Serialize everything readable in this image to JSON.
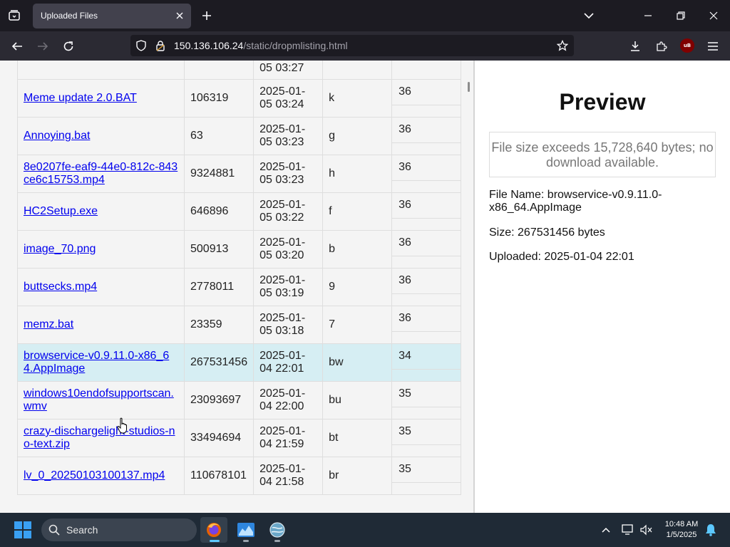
{
  "browser": {
    "tab_title": "Uploaded Files",
    "url_host": "150.136.106.24",
    "url_path": "/static/dropmlisting.html"
  },
  "file_list": {
    "partial_top_row": {
      "date": "05 03:27"
    },
    "rows": [
      {
        "name": "Meme update 2.0.BAT",
        "size": "106319",
        "date_line1": "2025-01-",
        "date_line2": "05 03:24",
        "hash": "k",
        "views": "36",
        "selected": false
      },
      {
        "name": "Annoying.bat",
        "size": "63",
        "date_line1": "2025-01-",
        "date_line2": "05 03:23",
        "hash": "g",
        "views": "36",
        "selected": false
      },
      {
        "name": "8e0207fe-eaf9-44e0-812c-843ce6c15753.mp4",
        "size": "9324881",
        "date_line1": "2025-01-",
        "date_line2": "05 03:23",
        "hash": "h",
        "views": "36",
        "selected": false
      },
      {
        "name": "HC2Setup.exe",
        "size": "646896",
        "date_line1": "2025-01-",
        "date_line2": "05 03:22",
        "hash": "f",
        "views": "36",
        "selected": false
      },
      {
        "name": "image_70.png",
        "size": "500913",
        "date_line1": "2025-01-",
        "date_line2": "05 03:20",
        "hash": "b",
        "views": "36",
        "selected": false
      },
      {
        "name": "buttsecks.mp4",
        "size": "2778011",
        "date_line1": "2025-01-",
        "date_line2": "05 03:19",
        "hash": "9",
        "views": "36",
        "selected": false
      },
      {
        "name": "memz.bat",
        "size": "23359",
        "date_line1": "2025-01-",
        "date_line2": "05 03:18",
        "hash": "7",
        "views": "36",
        "selected": false
      },
      {
        "name": "browservice-v0.9.11.0-x86_64.AppImage",
        "size": "267531456",
        "date_line1": "2025-01-",
        "date_line2": "04 22:01",
        "hash": "bw",
        "views": "34",
        "selected": true
      },
      {
        "name": "windows10endofsupportscan.wmv",
        "size": "23093697",
        "date_line1": "2025-01-",
        "date_line2": "04 22:00",
        "hash": "bu",
        "views": "35",
        "selected": false
      },
      {
        "name": "crazy-dischargelight-studios-no-text.zip",
        "size": "33494694",
        "date_line1": "2025-01-",
        "date_line2": "04 21:59",
        "hash": "bt",
        "views": "35",
        "selected": false
      },
      {
        "name": "lv_0_20250103100137.mp4",
        "size": "110678101",
        "date_line1": "2025-01-",
        "date_line2": "04 21:58",
        "hash": "br",
        "views": "35",
        "selected": false
      }
    ]
  },
  "preview": {
    "title": "Preview",
    "notice": "File size exceeds 15,728,640 bytes; no download available.",
    "file_name": "File Name: browservice-v0.9.11.0-x86_64.AppImage",
    "size": "Size: 267531456 bytes",
    "uploaded": "Uploaded: 2025-01-04 22:01"
  },
  "taskbar": {
    "search_label": "Search",
    "time": "10:48 AM",
    "date": "1/5/2025"
  },
  "icons": {
    "tab_list": "tab-list-icon",
    "close": "close-icon",
    "new_tab": "plus-icon",
    "back": "back-arrow-icon",
    "forward": "forward-arrow-icon",
    "reload": "reload-icon",
    "shield": "tracking-shield-icon",
    "lock": "connection-lock-icon",
    "bookmark": "star-icon",
    "downloads": "download-icon",
    "extensions": "puzzle-icon",
    "menu": "hamburger-icon",
    "ublock": "ublock-icon"
  }
}
